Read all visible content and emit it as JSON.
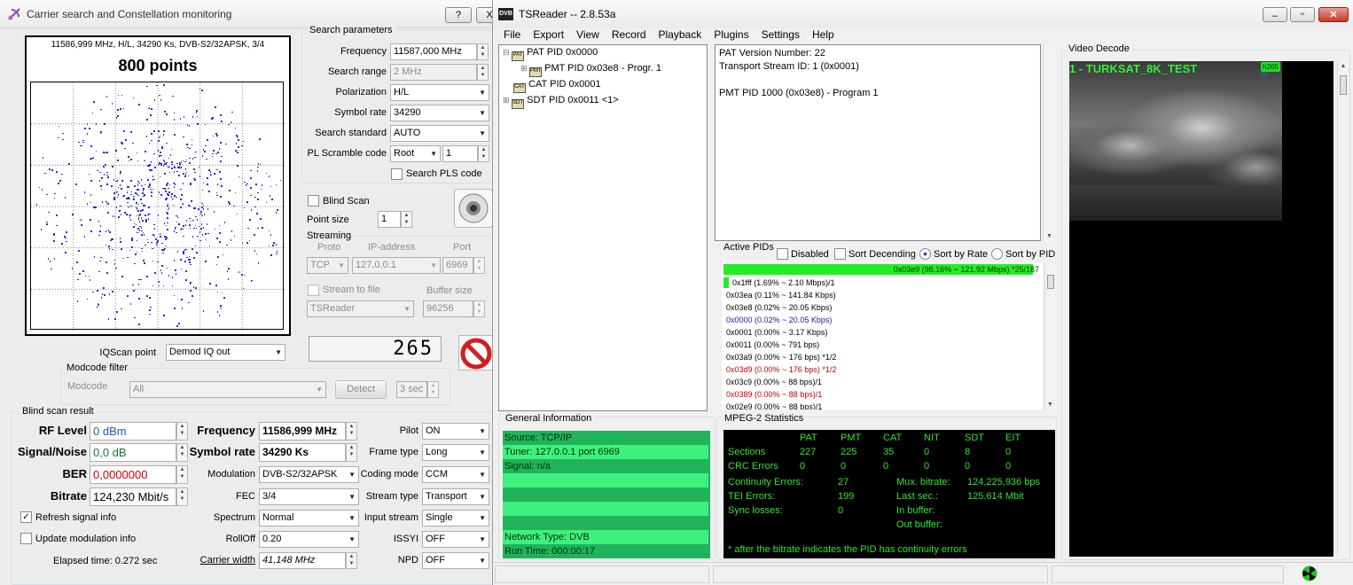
{
  "left_window": {
    "title": "Carrier search and Constellation monitoring",
    "help_btn": "?",
    "close_btn": "X",
    "constellation": {
      "info": "11586,999 MHz, H/L, 34290 Ks, DVB-S2/32APSK, 3/4",
      "points_label": "800 points"
    },
    "search_params": {
      "title": "Search parameters",
      "frequency_label": "Frequency",
      "frequency_value": "11587,000 MHz",
      "range_label": "Search range",
      "range_value": "2 MHz",
      "polarization_label": "Polarization",
      "polarization_value": "H/L",
      "symbol_rate_label": "Symbol rate",
      "symbol_rate_value": "34290",
      "standard_label": "Search standard",
      "standard_value": "AUTO",
      "pls_label": "PL Scramble code",
      "pls_mode": "Root",
      "pls_value": "1",
      "search_pls_label": "Search PLS code"
    },
    "blind_scan_label": "Blind Scan",
    "point_size_label": "Point size",
    "point_size_value": "1",
    "streaming": {
      "title": "Streaming",
      "proto_label": "Proto",
      "ip_label": "IP-address",
      "port_label": "Port",
      "proto_value": "TCP",
      "ip_value": "127.0.0.1",
      "port_value": "6969",
      "stream_to_file_label": "Stream to file",
      "buffer_label": "Buffer size",
      "target_value": "TSReader",
      "buffer_value": "96256"
    },
    "counter_value": "265",
    "iqscan_label": "IQScan point",
    "iqscan_value": "Demod IQ out",
    "modcode": {
      "title": "Modcode filter",
      "label": "Modcode",
      "value": "All",
      "detect_btn": "Detect",
      "sec_value": "3 sec"
    },
    "result": {
      "title": "Blind scan result",
      "rf_label": "RF Level",
      "rf_value": "0 dBm",
      "snr_label": "Signal/Noise",
      "snr_value": "0,0 dB",
      "ber_label": "BER",
      "ber_value": "0,0000000",
      "bitrate_label": "Bitrate",
      "bitrate_value": "124,230 Mbit/s",
      "freq_label": "Frequency",
      "freq_value": "11586,999 MHz",
      "sr_label": "Symbol rate",
      "sr_value": "34290 Ks",
      "mod_label": "Modulation",
      "mod_value": "DVB-S2/32APSK",
      "fec_label": "FEC",
      "fec_value": "3/4",
      "spectrum_label": "Spectrum",
      "spectrum_value": "Normal",
      "rolloff_label": "RollOff",
      "rolloff_value": "0.20",
      "carrier_width_label": "Carrier width",
      "carrier_width_value": "41,148 MHz",
      "pilot_label": "Pilot",
      "pilot_value": "ON",
      "frame_label": "Frame type",
      "frame_value": "Long",
      "coding_label": "Coding mode",
      "coding_value": "CCM",
      "stream_type_label": "Stream type",
      "stream_type_value": "Transport",
      "input_stream_label": "Input stream",
      "input_stream_value": "Single",
      "issyi_label": "ISSYI",
      "issyi_value": "OFF",
      "npd_label": "NPD",
      "npd_value": "OFF",
      "refresh_label": "Refresh signal info",
      "update_mod_label": "Update modulation info",
      "elapsed": "Elapsed time: 0.272 sec"
    }
  },
  "tsreader": {
    "title": "TSReader -- 2.8.53a",
    "app_icon": "DVB",
    "menu": [
      "File",
      "Export",
      "View",
      "Record",
      "Playback",
      "Plugins",
      "Settings",
      "Help"
    ],
    "tree": [
      "PAT PID 0x0000",
      "PMT PID 0x03e8 - Progr. 1",
      "CAT PID 0x0001",
      "SDT PID 0x0011 <1>"
    ],
    "details": [
      "PAT Version Number: 22",
      "Transport Stream ID: 1 (0x0001)",
      "",
      "PMT PID 1000 (0x03e8) - Program 1"
    ],
    "active_pids": {
      "title": "Active PIDs",
      "disabled_label": "Disabled",
      "sort_desc_label": "Sort Decending",
      "sort_rate_label": "Sort by Rate",
      "sort_pid_label": "Sort by PID",
      "top_bar_text": "0x03e9 (98.16% ~ 121.92 Mbps) *25/187",
      "top_bar_fraction": 0.9816,
      "rows": [
        {
          "text": "0x1fff (1.69% ~ 2.10 Mbps)/1",
          "color": "#000000",
          "fraction": 0.0169
        },
        {
          "text": "0x03ea (0.11% ~ 141.84 Kbps)",
          "color": "#000000"
        },
        {
          "text": "0x03e8 (0.02% ~ 20.05 Kbps)",
          "color": "#000000"
        },
        {
          "text": "0x0000 (0.02% ~ 20.05 Kbps)",
          "color": "#1a1aa0"
        },
        {
          "text": "0x0001 (0.00% ~ 3.17 Kbps)",
          "color": "#000000"
        },
        {
          "text": "0x0011 (0.00% ~ 791 bps)",
          "color": "#000000"
        },
        {
          "text": "0x03a9 (0.00% ~ 176 bps) *1/2",
          "color": "#000000"
        },
        {
          "text": "0x03d9 (0.00% ~ 176 bps) *1/2",
          "color": "#c00000"
        },
        {
          "text": "0x03c9 (0.00% ~ 88 bps)/1",
          "color": "#000000"
        },
        {
          "text": "0x0389 (0.00% ~ 88 bps)/1",
          "color": "#c00000"
        },
        {
          "text": "0x02e9 (0.00% ~ 88 bps)/1",
          "color": "#000000"
        }
      ]
    },
    "general": {
      "title": "General Information",
      "lines": [
        "Source: TCP/IP",
        "Tuner: 127.0.0.1 port 6969",
        "Signal: n/a",
        "",
        "",
        "",
        "",
        "Network Type: DVB",
        "Run Time: 000:00:17"
      ]
    },
    "mpeg2": {
      "title": "MPEG-2 Statistics",
      "headers": [
        "PAT",
        "PMT",
        "CAT",
        "NIT",
        "SDT",
        "EIT"
      ],
      "sections_label": "Sections",
      "sections": [
        "227",
        "225",
        "35",
        "0",
        "8",
        "0"
      ],
      "crc_label": "CRC Errors",
      "crc": [
        "0",
        "0",
        "0",
        "0",
        "0",
        "0"
      ],
      "cont_label": "Continuity Errors:",
      "cont_value": "27",
      "tei_label": "TEI Errors:",
      "tei_value": "199",
      "sync_label": "Sync losses:",
      "sync_value": "0",
      "mux_label": "Mux. bitrate:",
      "mux_value": "124,225,936 bps",
      "last_label": "Last sec.:",
      "last_value": "125.614 Mbit",
      "inbuf_label": "In buffer:",
      "outbuf_label": "Out buffer:",
      "footnote": "* after the bitrate indicates the PID has continuity errors"
    },
    "video": {
      "title": "Video Decode",
      "overlay": "1 - TURKSAT_8K_TEST",
      "codec_badge": "h265"
    }
  }
}
